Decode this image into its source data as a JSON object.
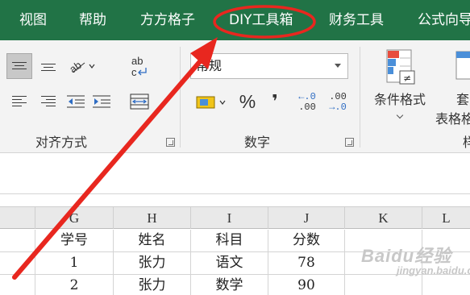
{
  "tabs": [
    {
      "label": "视图"
    },
    {
      "label": "帮助"
    },
    {
      "label": "方方格子"
    },
    {
      "label": "DIY工具箱"
    },
    {
      "label": "财务工具"
    },
    {
      "label": "公式向导"
    }
  ],
  "ribbon": {
    "alignment_group": {
      "label": "对齐方式"
    },
    "number_group": {
      "label": "数字",
      "format_value": "常规",
      "percent_symbol": "%",
      "comma_symbol": "❜",
      "increase_decimal": {
        "top": "←.0",
        "bottom": ".00"
      },
      "decrease_decimal": {
        "top": ".00",
        "bottom": "→.0"
      }
    },
    "styles_group": {
      "conditional_format_label": "条件格式",
      "table_format_label_line1": "套",
      "table_format_label_line2": "表格格",
      "partial_group_label": "样"
    }
  },
  "sheet": {
    "column_headers": [
      "G",
      "H",
      "I",
      "J",
      "K",
      "L"
    ],
    "rows": [
      [
        "学号",
        "姓名",
        "科目",
        "分数",
        "",
        ""
      ],
      [
        "1",
        "张力",
        "语文",
        "78",
        "",
        ""
      ],
      [
        "2",
        "张力",
        "数学",
        "90",
        "",
        ""
      ]
    ]
  },
  "watermark": {
    "brand": "Baidu经验",
    "sub": "jingyan.baidu.com"
  },
  "colors": {
    "ribbon_tab_bg": "#217346",
    "annotation_red": "#e8271f"
  }
}
